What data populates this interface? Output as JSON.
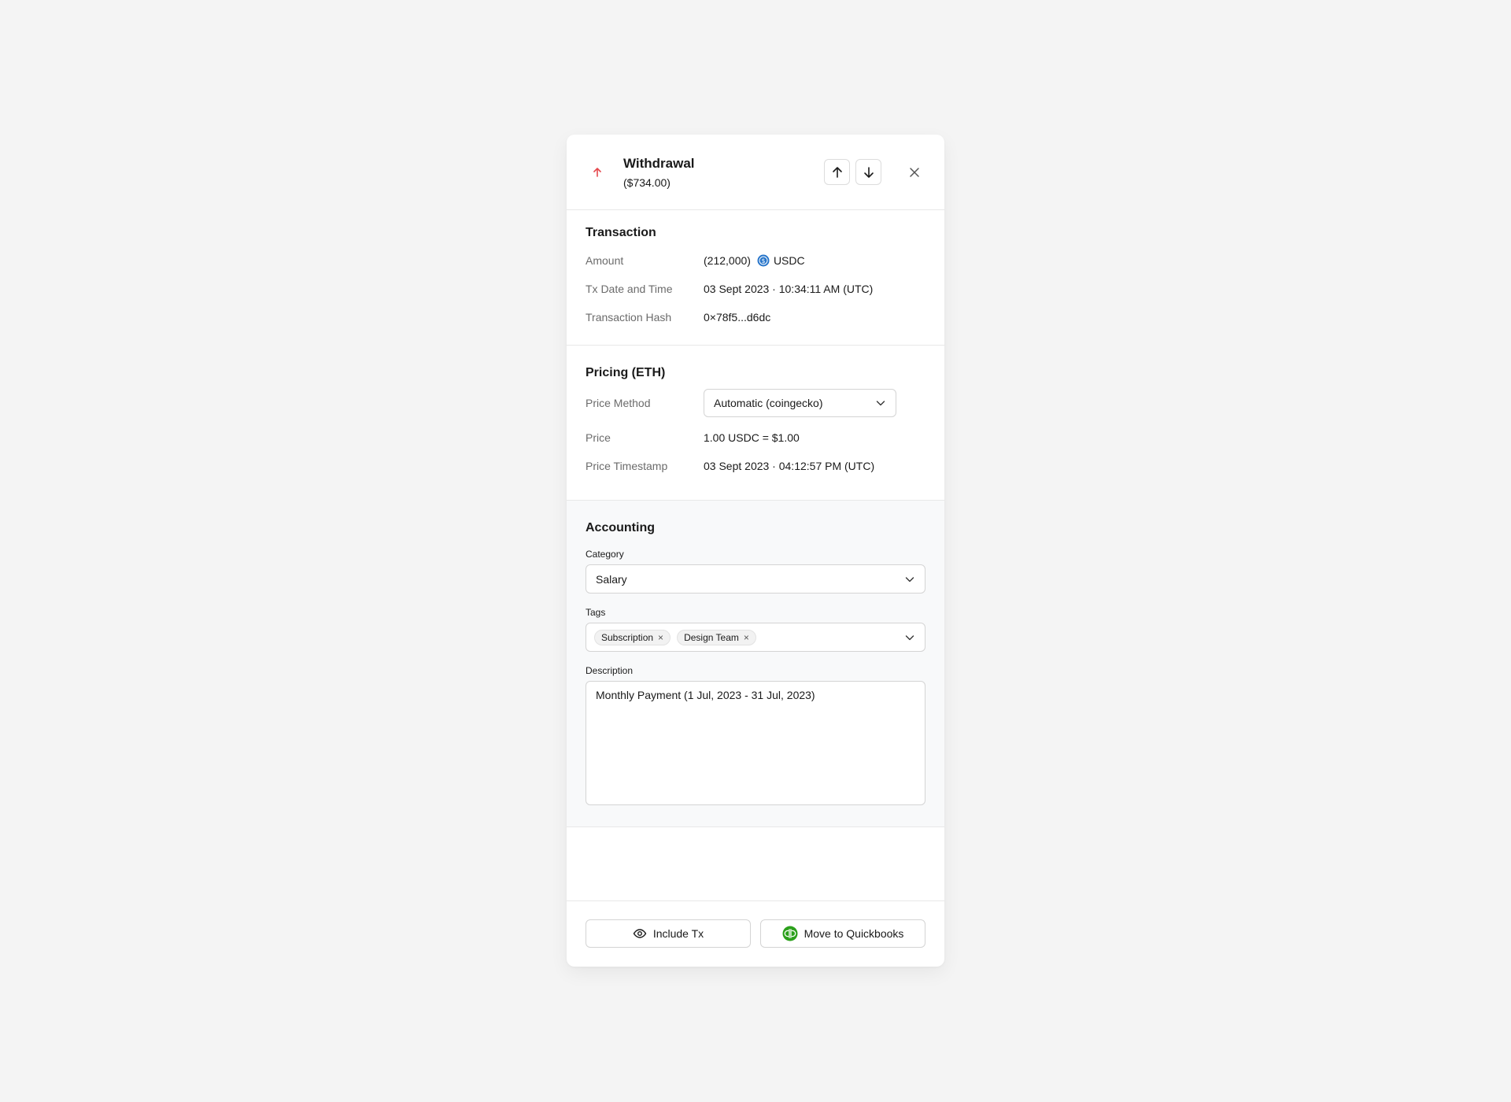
{
  "header": {
    "title": "Withdrawal",
    "subtitle": "($734.00)",
    "direction_icon": "arrow-up-icon",
    "direction_color": "#e5484d"
  },
  "transaction": {
    "section_title": "Transaction",
    "amount_label": "Amount",
    "amount_value": "(212,000)",
    "token": "USDC",
    "token_color": "#2775ca",
    "datetime_label": "Tx Date and Time",
    "datetime_value": "03 Sept 2023 · 10:34:11 AM (UTC)",
    "hash_label": "Transaction Hash",
    "hash_value": "0×78f5...d6dc",
    "link_color": "#1d6fd1"
  },
  "pricing": {
    "section_title": "Pricing (ETH)",
    "method_label": "Price Method",
    "method_value": "Automatic (coingecko)",
    "price_label": "Price",
    "price_value": "1.00 USDC = $1.00",
    "timestamp_label": "Price Timestamp",
    "timestamp_value": "03 Sept 2023 · 04:12:57 PM (UTC)"
  },
  "accounting": {
    "section_title": "Accounting",
    "category_label": "Category",
    "category_value": "Salary",
    "tags_label": "Tags",
    "tags": [
      "Subscription",
      "Design Team"
    ],
    "tag_remove_glyph": "×",
    "description_label": "Description",
    "description_value": "Monthly Payment (1 Jul, 2023 - 31 Jul, 2023)"
  },
  "footer": {
    "include_label": "Include Tx",
    "quickbooks_label": "Move to Quickbooks",
    "quickbooks_color": "#2ca01c"
  }
}
